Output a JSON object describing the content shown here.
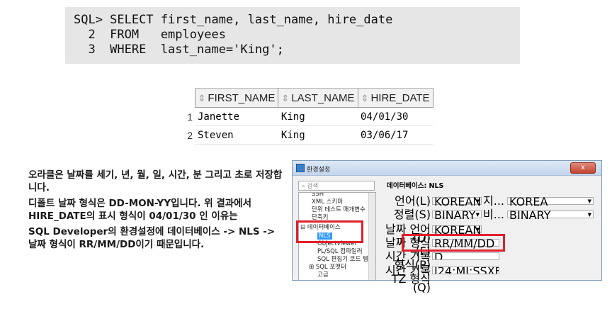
{
  "sql": {
    "line1": "SQL> SELECT first_name, last_name, hire_date",
    "line2": "  2  FROM   employees",
    "line3": "  3  WHERE  last_name='King';"
  },
  "result": {
    "columns": [
      "FIRST_NAME",
      "LAST_NAME",
      "HIRE_DATE"
    ],
    "rows": [
      {
        "num": "1",
        "first_name": "Janette",
        "last_name": "King",
        "hire_date": "04/01/30"
      },
      {
        "num": "2",
        "first_name": "Steven",
        "last_name": "King",
        "hire_date": "03/06/17"
      }
    ]
  },
  "notes": {
    "p1": "오라클은 날짜를 세기, 년, 월, 일, 시간, 분 그리고 초로 저장합니다.",
    "p2": "디폴트 날짜 형식은 DD-MON-YY입니다. 위 결과에서 HIRE_DATE의 표시 형식이 04/01/30 인 이유는",
    "p3": "SQL Developer의 환경설정에 데이터베이스 -> NLS -> 날짜 형식이 RR/MM/DD이기 때문입니다."
  },
  "dialog": {
    "title": "환경설정",
    "close": "x",
    "search_placeholder": "검색",
    "tree": {
      "item_ssh": "SSH",
      "item_xml": "XML 스키마",
      "item_unit": "단위 테스트 매개변수",
      "item_shortcut": "단축키",
      "item_db": "데이터베이스",
      "item_nls": "NLS",
      "item_objview": "Objectviewer",
      "item_plsql": "PL/SQL 컴파일러",
      "item_sqleditor": "SQL 편집기 코드 템",
      "item_formatter": "SQL 포맷터",
      "item_adv": "고급"
    },
    "panel_title": "데이터베이스: NLS",
    "fields": {
      "lang_label": "언어(L)",
      "lang_value": "KOREAN",
      "terr_label": "지...",
      "terr_value": "KOREA",
      "sort_label": "정렬(S)",
      "sort_value": "BINARY",
      "comp_label": "비...",
      "comp_value": "BINARY",
      "datelang_label": "날짜 언어(D)",
      "datelang_value": "KOREAN",
      "datefmt_label": "날짜 형식(F)",
      "datefmt_value": "RR/MM/DD",
      "tsfmt_label": "시간 기록 형식(P)",
      "tsfmt_value": "D HH24:MI:SSXFF",
      "tstzfmt_label": "시간 기록 TZ 형식(Q)",
      "tstzfmt_value": "I24:MI:SSXFF TZR"
    }
  }
}
